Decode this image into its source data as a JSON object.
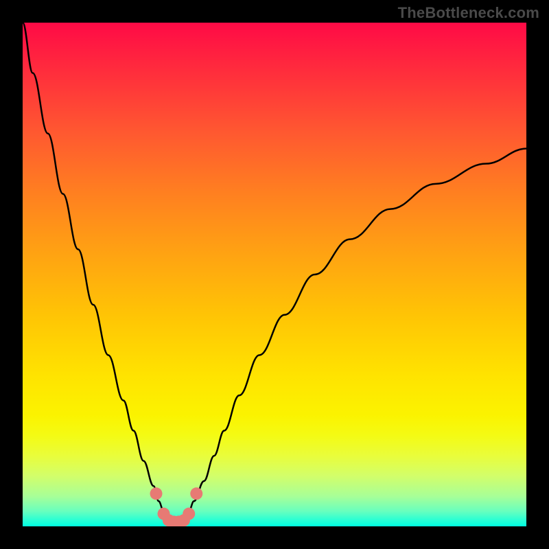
{
  "watermark": "TheBottleneck.com",
  "colors": {
    "background": "#000000",
    "curve": "#000000",
    "marker_fill": "#e77a74",
    "gradient": [
      "#ff0a46",
      "#ffe300",
      "#00ffe0"
    ]
  },
  "chart_data": {
    "type": "line",
    "title": "",
    "xlabel": "",
    "ylabel": "",
    "xlim": [
      0,
      100
    ],
    "ylim": [
      0,
      100
    ],
    "grid": false,
    "annotations": [
      "TheBottleneck.com"
    ],
    "series": [
      {
        "name": "curve",
        "x": [
          0,
          2,
          5,
          8,
          11,
          14,
          17,
          20,
          22,
          24,
          26,
          27,
          28,
          29,
          30,
          31,
          32,
          33,
          34,
          36,
          38,
          40,
          43,
          47,
          52,
          58,
          65,
          73,
          82,
          92,
          100
        ],
        "values": [
          100,
          90,
          78,
          66,
          55,
          44,
          34,
          25,
          19,
          13,
          8,
          5,
          3,
          1.5,
          1,
          1,
          1.5,
          3,
          5,
          9,
          14,
          19,
          26,
          34,
          42,
          50,
          57,
          63,
          68,
          72,
          75
        ]
      }
    ],
    "markers": [
      {
        "x": 26.5,
        "y": 6.5
      },
      {
        "x": 28.0,
        "y": 2.5
      },
      {
        "x": 29.0,
        "y": 1.2
      },
      {
        "x": 30.0,
        "y": 0.9
      },
      {
        "x": 31.0,
        "y": 0.9
      },
      {
        "x": 32.0,
        "y": 1.2
      },
      {
        "x": 33.0,
        "y": 2.5
      },
      {
        "x": 34.5,
        "y": 6.5
      }
    ]
  }
}
